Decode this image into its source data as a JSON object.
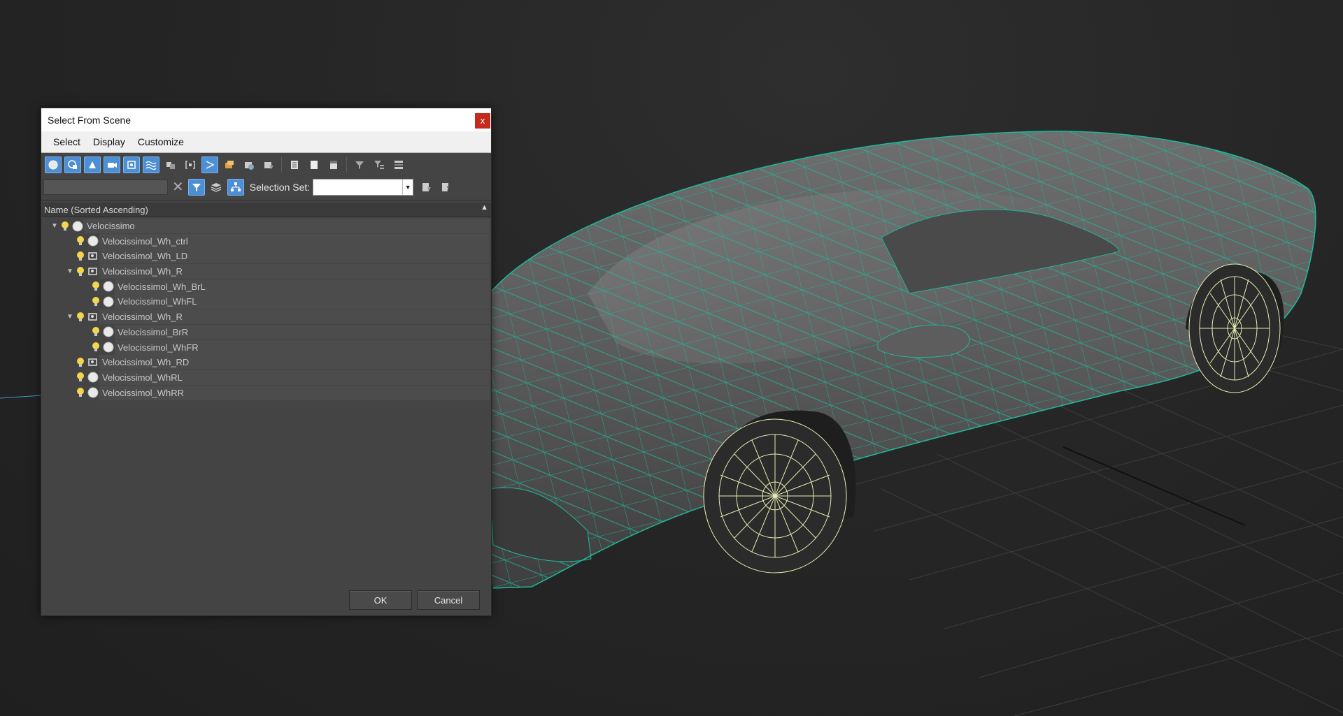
{
  "dialog": {
    "title": "Select From Scene",
    "close_label": "x",
    "menu": [
      "Select",
      "Display",
      "Customize"
    ],
    "search": {
      "value": ""
    },
    "selection_set_label": "Selection Set:",
    "selection_set_value": "",
    "column_header": "Name (Sorted Ascending)",
    "tree": [
      {
        "name": "Velocissimo",
        "icon": "sphere-icon",
        "expanded": true,
        "level": 0
      },
      {
        "name": "Velocissimol_Wh_ctrl",
        "icon": "sphere-icon",
        "level": 1
      },
      {
        "name": "Velocissimol_Wh_LD",
        "icon": "helper-icon",
        "level": 1
      },
      {
        "name": "Velocissimol_Wh_R",
        "icon": "helper-icon",
        "expanded": true,
        "level": 1
      },
      {
        "name": "Velocissimol_Wh_BrL",
        "icon": "sphere-icon",
        "level": 2
      },
      {
        "name": "Velocissimol_WhFL",
        "icon": "sphere-icon",
        "level": 2
      },
      {
        "name": "Velocissimol_Wh_R",
        "icon": "helper-icon",
        "expanded": true,
        "level": 1
      },
      {
        "name": "Velocissimol_BrR",
        "icon": "sphere-icon",
        "level": 2
      },
      {
        "name": "Velocissimol_WhFR",
        "icon": "sphere-icon",
        "level": 2
      },
      {
        "name": "Velocissimol_Wh_RD",
        "icon": "helper-icon",
        "level": 1
      },
      {
        "name": "Velocissimol_WhRL",
        "icon": "sphere-icon",
        "level": 1
      },
      {
        "name": "Velocissimol_WhRR",
        "icon": "sphere-icon",
        "level": 1
      }
    ],
    "ok_label": "OK",
    "cancel_label": "Cancel"
  },
  "colors": {
    "accent": "#4d8fd6",
    "wireframe": "#1fb89a",
    "wheel_wire": "#e6ecb0",
    "close": "#c42b1c"
  }
}
